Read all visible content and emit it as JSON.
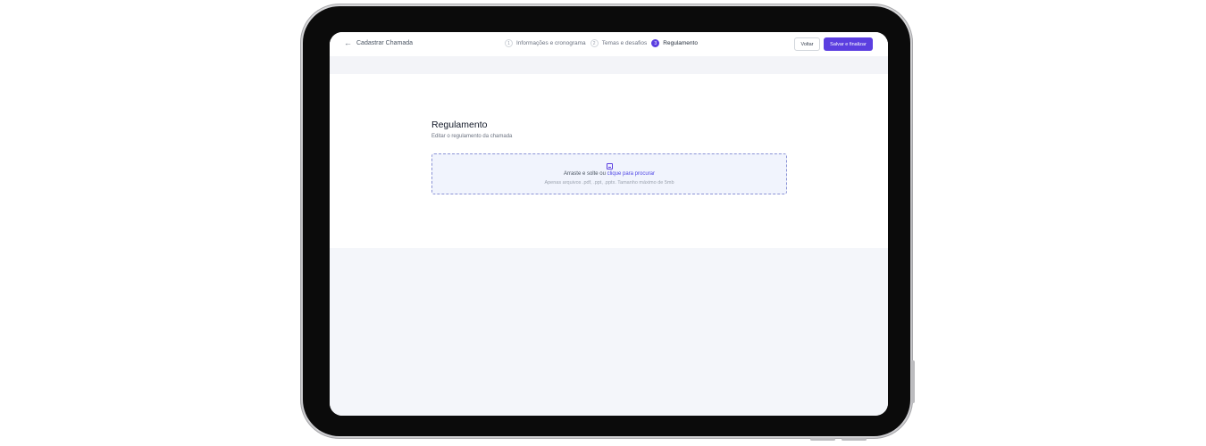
{
  "header": {
    "back_label": "Cadastrar Chamada",
    "back_icon": "arrow-left-icon",
    "steps": [
      {
        "number": "1",
        "label": "Informações e cronograma",
        "active": false
      },
      {
        "number": "2",
        "label": "Temas e desafios",
        "active": false
      },
      {
        "number": "3",
        "label": "Regulamento",
        "active": true
      }
    ],
    "voltar_label": "Voltar",
    "salvar_label": "Salvar e finalizar"
  },
  "main": {
    "title": "Regulamento",
    "subtitle": "Editar o regulamento da chamada",
    "dropzone": {
      "icon": "file-icon",
      "text_prefix": "Arraste e solte ou",
      "link_text": "clique para procurar",
      "hint": "Apenas arquivos .pdf, .ppt, .pptx. Tamanho máximo de 5mb"
    }
  },
  "colors": {
    "accent": "#5b3ee0",
    "link": "#4f46e5",
    "dropzone_bg": "#f1f4fd",
    "dropzone_border": "#8b93d6",
    "page_bg": "#f4f6fa"
  }
}
